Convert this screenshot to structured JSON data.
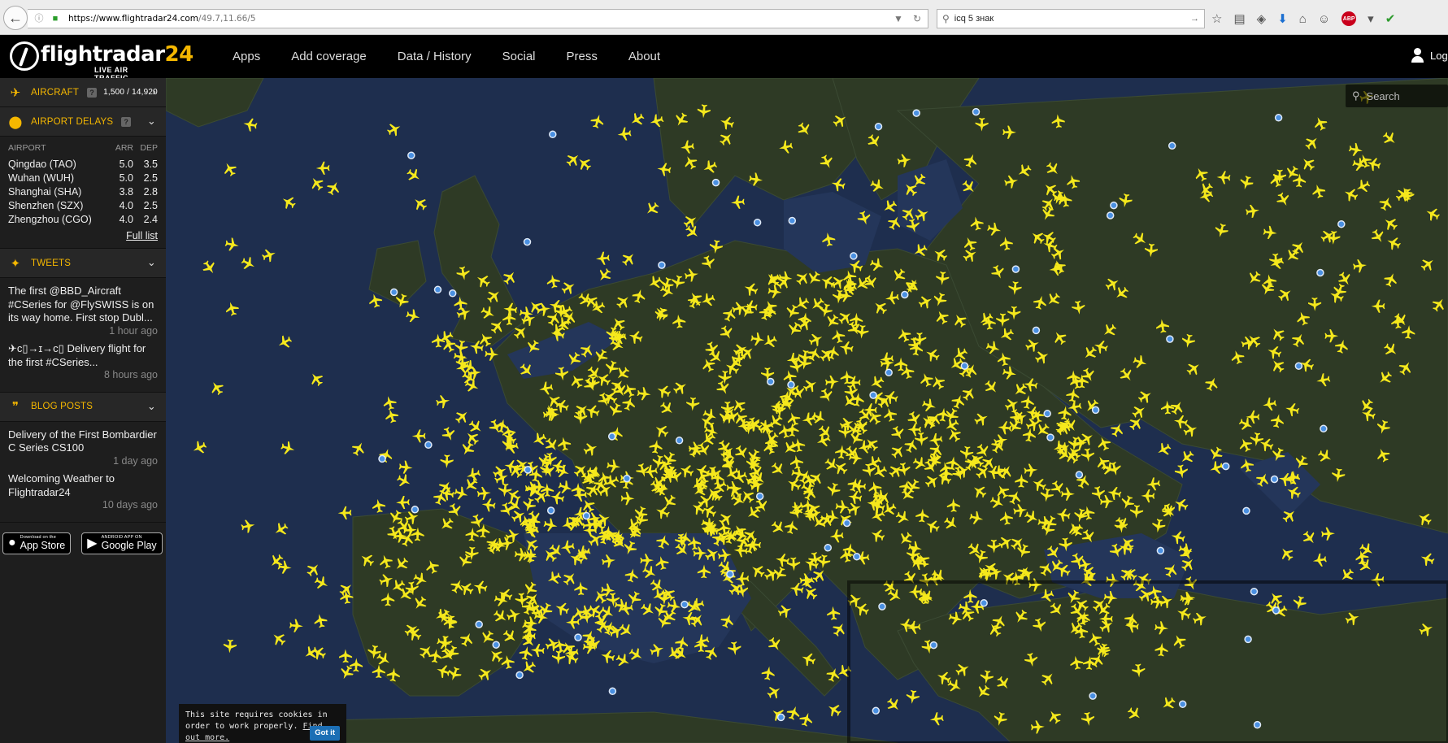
{
  "browser": {
    "url_host": "https://www.flightradar24.com",
    "url_path": "/49.7,11.66/5",
    "search_value": "icq 5 знак"
  },
  "nav": {
    "logo_word": "flightradar",
    "logo_num": "24",
    "logo_tag": "LIVE AIR TRAFFIC",
    "items": [
      "Apps",
      "Add coverage",
      "Data / History",
      "Social",
      "Press",
      "About"
    ],
    "login": "Log"
  },
  "aircraft": {
    "label": "AIRCRAFT",
    "count": "1,500 / 14,920"
  },
  "delays": {
    "label": "AIRPORT DELAYS",
    "columns": [
      "AIRPORT",
      "ARR",
      "DEP"
    ],
    "rows": [
      [
        "Qingdao (TAO)",
        "5.0",
        "3.5"
      ],
      [
        "Wuhan (WUH)",
        "5.0",
        "2.5"
      ],
      [
        "Shanghai (SHA)",
        "3.8",
        "2.8"
      ],
      [
        "Shenzhen (SZX)",
        "4.0",
        "2.5"
      ],
      [
        "Zhengzhou (CGO)",
        "4.0",
        "2.4"
      ]
    ],
    "full_list": "Full list"
  },
  "tweets": {
    "label": "TWEETS",
    "items": [
      {
        "text": "The first @BBD_Aircraft #CSeries for @FlySWISS is on its way home. First stop Dubl...",
        "time": "1 hour ago"
      },
      {
        "text": "✈c▯→ɪ→c▯ Delivery flight for the first #CSeries...",
        "time": "8 hours ago"
      }
    ]
  },
  "blog": {
    "label": "BLOG POSTS",
    "items": [
      {
        "text": "Delivery of the First Bombardier C Series CS100",
        "time": "1 day ago"
      },
      {
        "text": "Welcoming Weather to Flightradar24",
        "time": "10 days ago"
      }
    ]
  },
  "badges": {
    "appstore_small": "Download on the",
    "appstore_large": "App Store",
    "google_small": "ANDROID APP ON",
    "google_large": "Google Play"
  },
  "map": {
    "search_placeholder": "Search",
    "cookie_text": "This site requires cookies in order to work properly.",
    "cookie_link": "Find out more.",
    "cookie_button": "Got it",
    "plane_color": "#f5e81c",
    "airport_color": "#4a90e2"
  }
}
